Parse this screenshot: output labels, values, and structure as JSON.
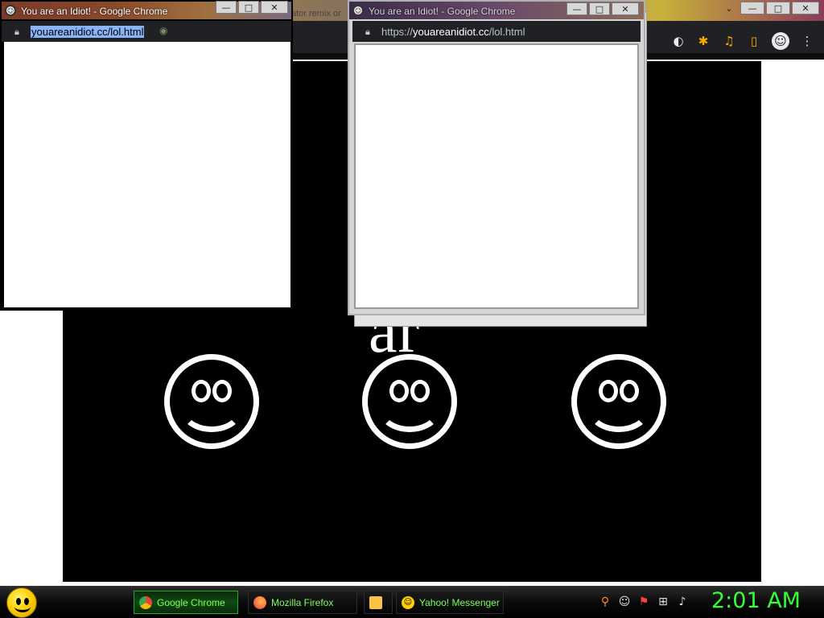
{
  "main_window": {
    "tab_partial_text": "ator remix or",
    "idiot_text": "ar                        t",
    "idiot_text_small": "!",
    "controls": {
      "minimize": "—",
      "maximize": "□",
      "close": "✕",
      "extra": "⌄"
    },
    "toolbar_icons": {
      "trans_flag": "◐",
      "extensions": "✱",
      "media": "♫",
      "sidebar": "▯",
      "profile": "☺",
      "menu": "⋮"
    }
  },
  "popup1": {
    "title": "You are an Idiot! - Google Chrome",
    "url_host": "youareanidiot.cc",
    "url_path": "/lol.html",
    "url_extra": "◉"
  },
  "popup2": {
    "title": "You are an Idiot! - Google Chrome",
    "url_scheme": "https://",
    "url_host": "youareanidiot.cc",
    "url_path": "/lol.html",
    "controls": {
      "minimize": "—",
      "maximize": "□",
      "close": "✕"
    }
  },
  "taskbar": {
    "tasks": [
      {
        "label": "Google Chrome",
        "active": true,
        "icon": "chrome-icon"
      },
      {
        "label": "Mozilla Firefox",
        "active": false,
        "icon": "firefox-icon"
      },
      {
        "label": "",
        "active": false,
        "icon": "folder-icon"
      },
      {
        "label": "Yahoo! Messenger",
        "active": false,
        "icon": "yahoo-messenger-icon"
      }
    ],
    "clock": "2:01 AM"
  },
  "colors": {
    "taskbar_text": "#7dff5a",
    "clock": "#33ff33",
    "chrome_toolbar": "#202124",
    "url_selection": "#8ab4f8"
  }
}
